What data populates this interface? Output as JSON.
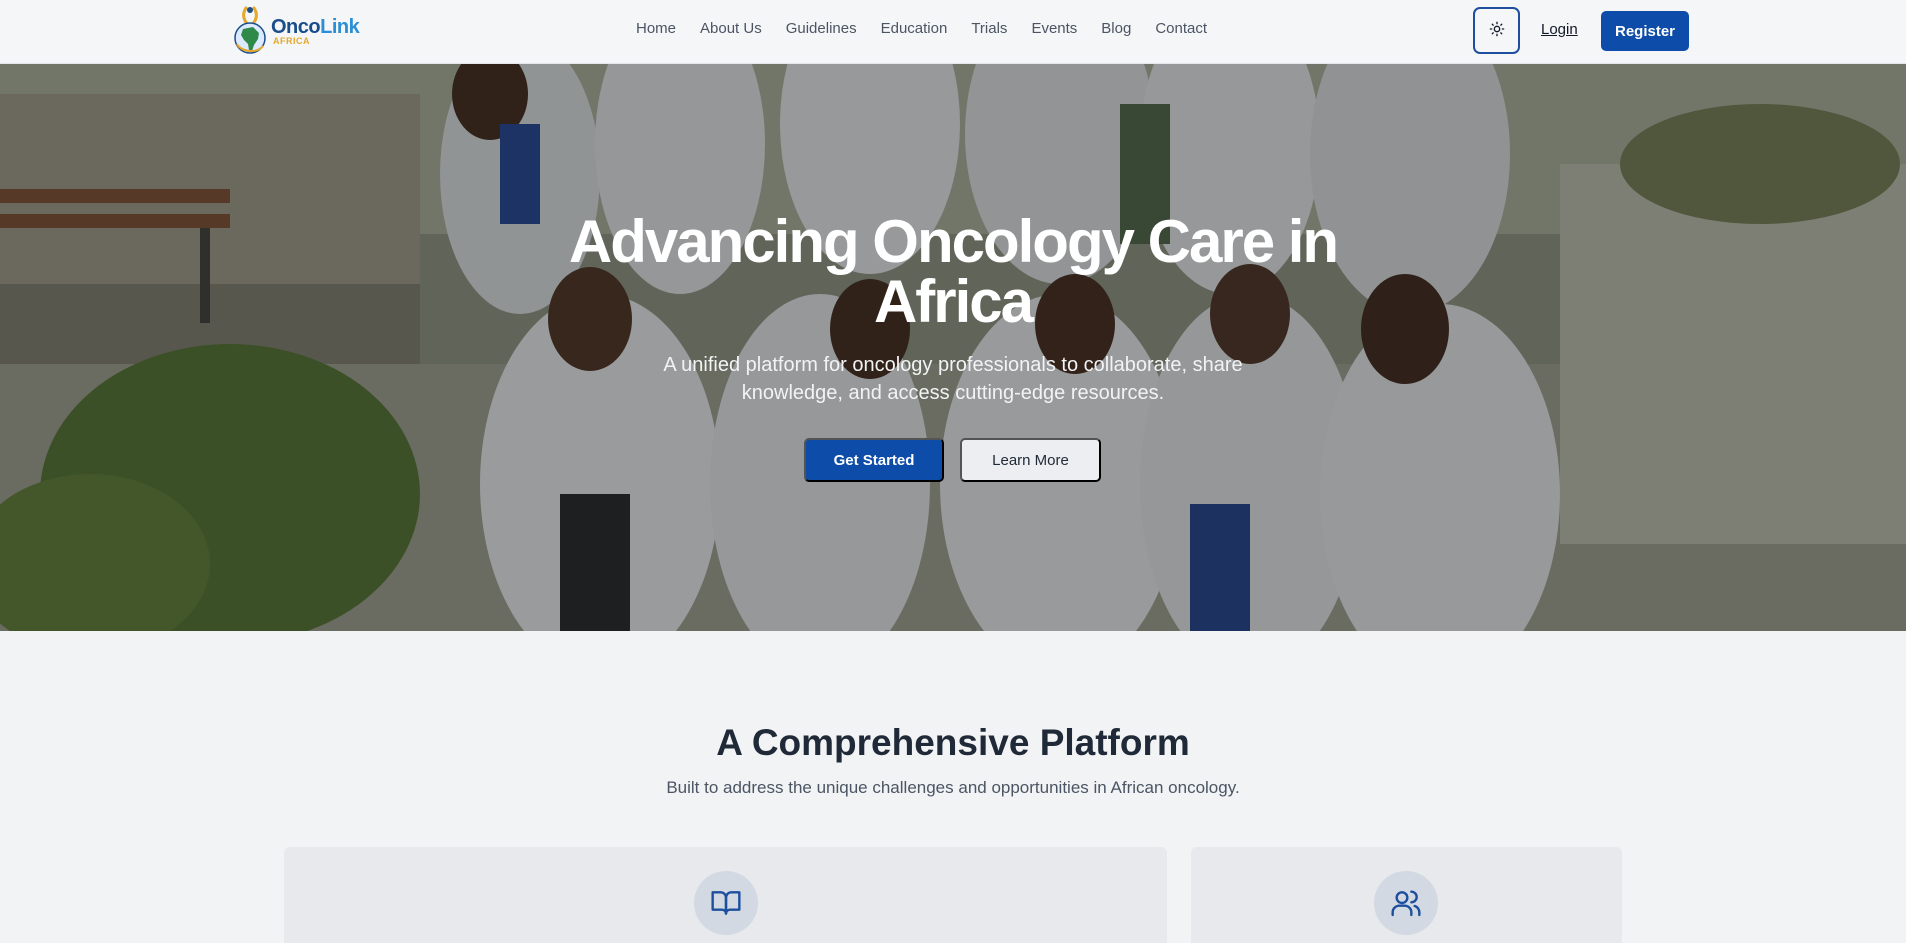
{
  "brand": {
    "name_part1": "Onco",
    "name_part2": "Link",
    "subtitle": "AFRICA",
    "colors": {
      "primary": "#0d4ca8",
      "logo_blue": "#1a4e8a",
      "logo_light": "#2a8fd6",
      "logo_accent": "#e6a72a"
    }
  },
  "nav": {
    "items": [
      {
        "label": "Home"
      },
      {
        "label": "About Us"
      },
      {
        "label": "Guidelines"
      },
      {
        "label": "Education"
      },
      {
        "label": "Trials"
      },
      {
        "label": "Events"
      },
      {
        "label": "Blog"
      },
      {
        "label": "Contact"
      }
    ]
  },
  "header": {
    "theme_icon": "sun-icon",
    "login_label": "Login",
    "register_label": "Register"
  },
  "hero": {
    "title_line1": "Advancing Oncology Care in",
    "title_line2": "Africa",
    "subtitle_line1": "A unified platform for oncology professionals to collaborate, share",
    "subtitle_line2": "knowledge, and access cutting-edge resources.",
    "primary_cta": "Get Started",
    "secondary_cta": "Learn More",
    "background": "group-of-doctors-photo"
  },
  "platform": {
    "title": "A Comprehensive Platform",
    "subtitle": "Built to address the unique challenges and opportunities in African oncology.",
    "cards": [
      {
        "icon": "book-open-icon"
      },
      {
        "icon": "users-icon"
      }
    ]
  }
}
